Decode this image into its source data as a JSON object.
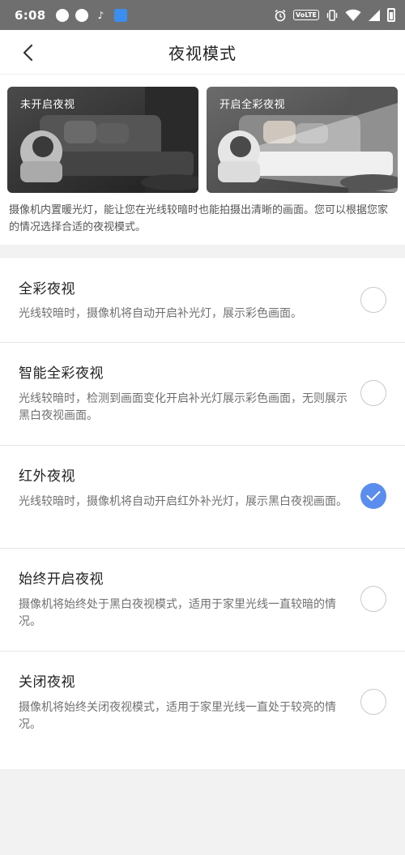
{
  "status_bar": {
    "time": "6:08",
    "volte_label": "VoLTE",
    "left_icons": [
      "chat-icon",
      "bird-icon",
      "tiktok-icon",
      "blue-app-icon"
    ],
    "right_icons": [
      "alarm-icon",
      "volte-icon",
      "vibrate-icon",
      "wifi-icon",
      "signal-icon",
      "battery-icon"
    ]
  },
  "header": {
    "title": "夜视模式",
    "back_icon": "chevron-left-icon"
  },
  "intro": {
    "image_left_label": "未开启夜视",
    "image_right_label": "开启全彩夜视",
    "description": "摄像机内置暖光灯，能让您在光线较暗时也能拍摄出清晰的画面。您可以根据您家的情况选择合适的夜视模式。"
  },
  "options": [
    {
      "title": "全彩夜视",
      "description": "光线较暗时，摄像机将自动开启补光灯，展示彩色画面。",
      "selected": false
    },
    {
      "title": "智能全彩夜视",
      "description": "光线较暗时，检测到画面变化开启补光灯展示彩色画面，无则展示黑白夜视画面。",
      "selected": false
    },
    {
      "title": "红外夜视",
      "description": "光线较暗时，摄像机将自动开启红外补光灯，展示黑白夜视画面。",
      "selected": true
    },
    {
      "title": "始终开启夜视",
      "description": "摄像机将始终处于黑白夜视模式，适用于家里光线一直较暗的情况。",
      "selected": false
    },
    {
      "title": "关闭夜视",
      "description": "摄像机将始终关闭夜视模式，适用于家里光线一直处于较亮的情况。",
      "selected": false
    }
  ],
  "colors": {
    "accent": "#5b8def",
    "status_bar": "#6f6f6f",
    "background": "#f2f2f2"
  }
}
